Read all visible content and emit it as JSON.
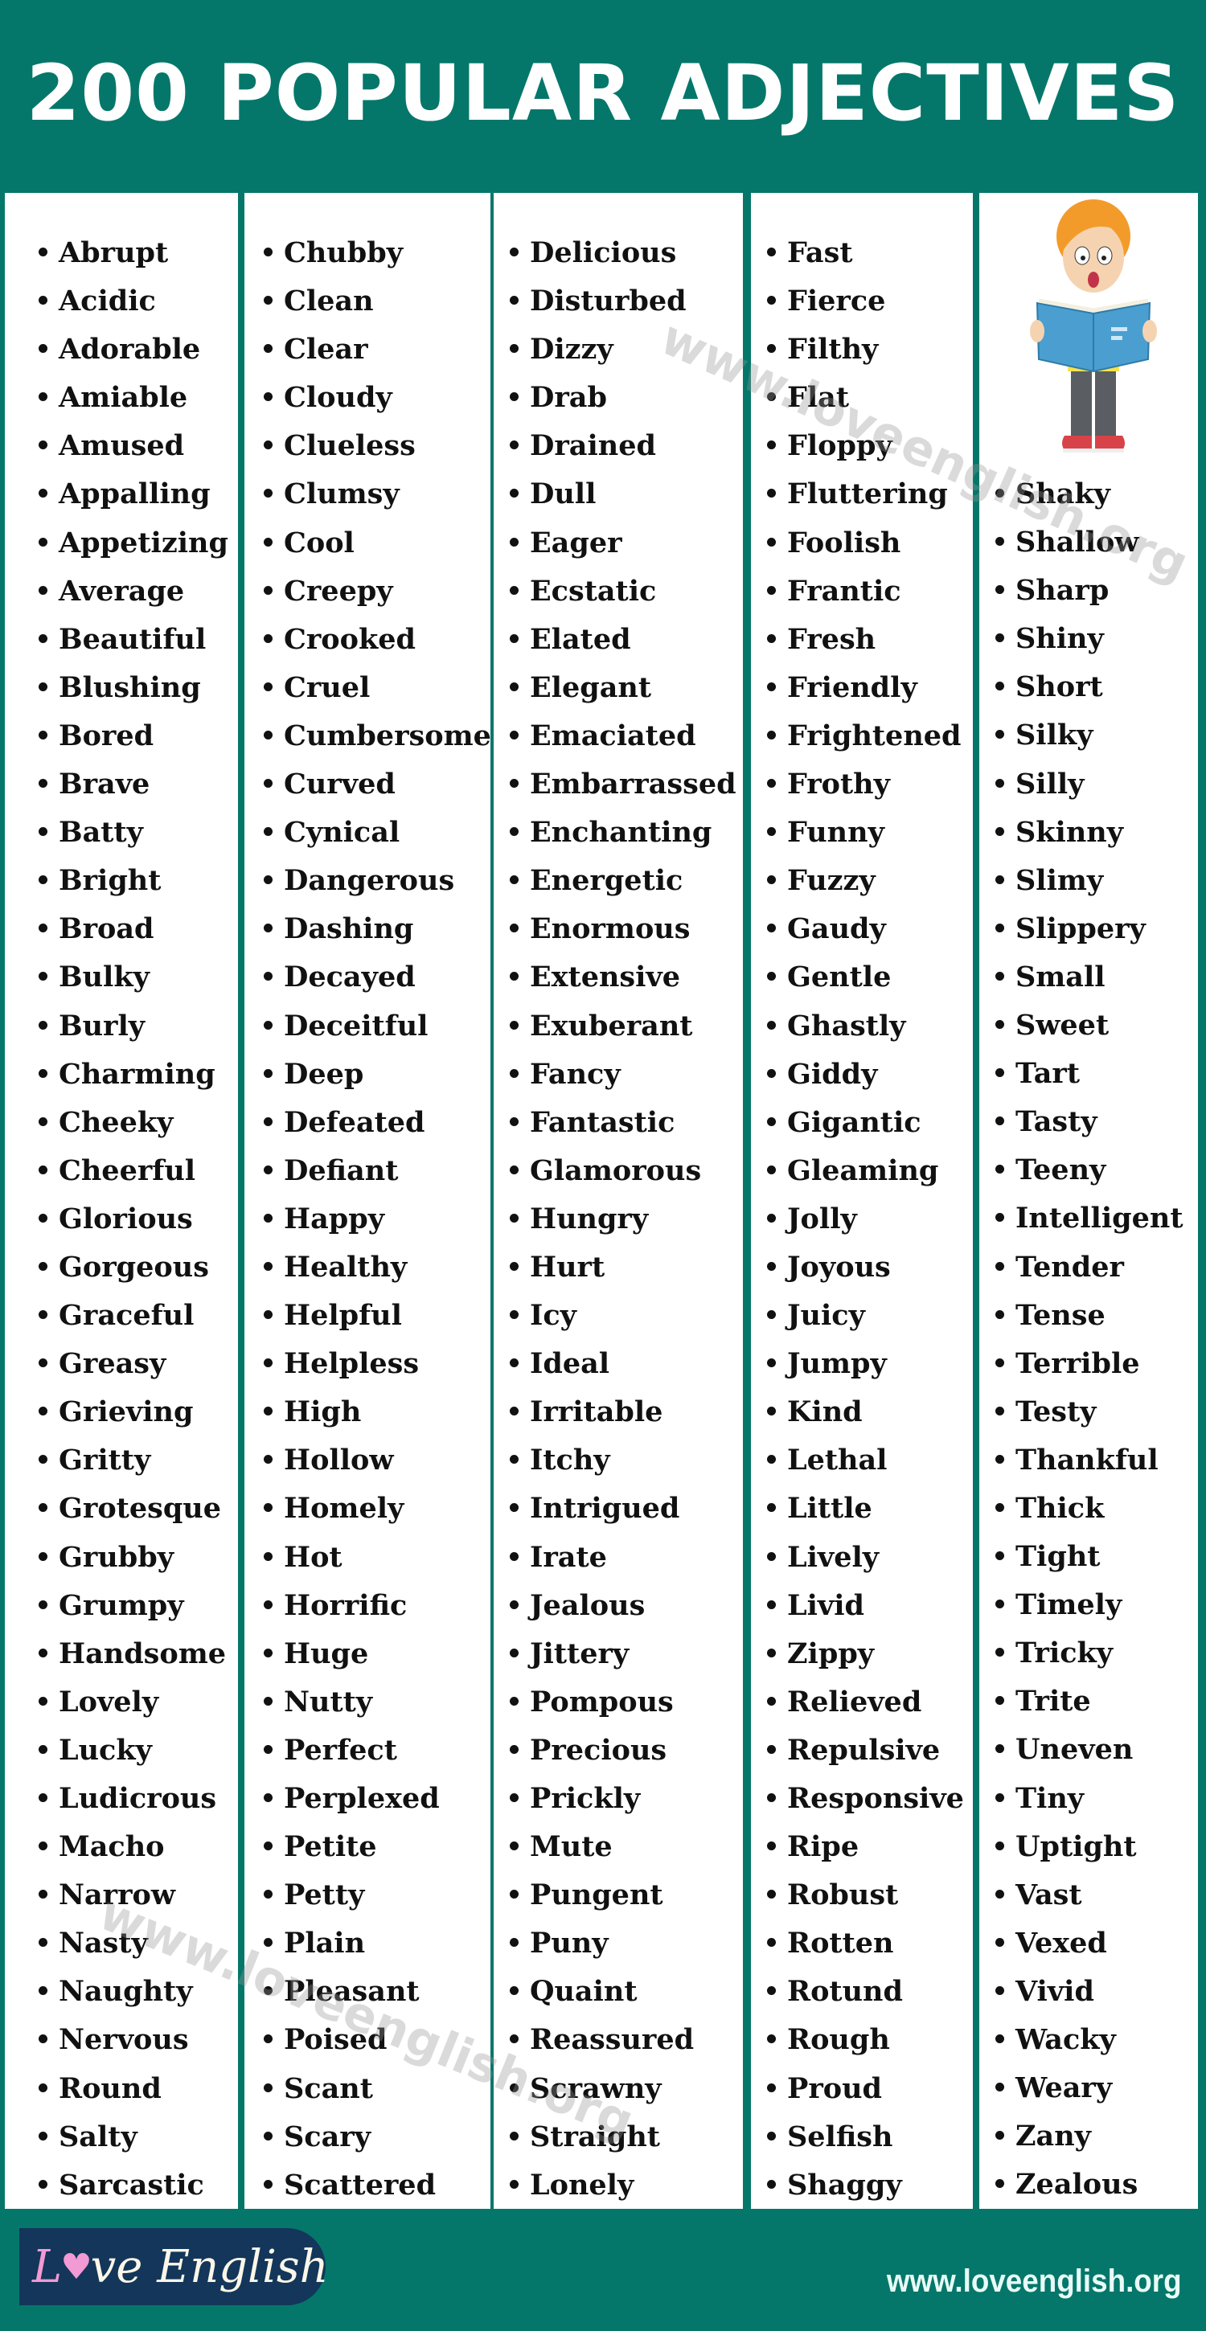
{
  "header": {
    "title": "200 POPULAR ADJECTIVES"
  },
  "colors": {
    "background": "#04776a",
    "panel": "#ffffff",
    "logo_bg": "#13365a",
    "logo_pink": "#f29ad3"
  },
  "columns": [
    [
      "Abrupt",
      "Acidic",
      "Adorable",
      "Amiable",
      "Amused",
      "Appalling",
      "Appetizing",
      "Average",
      "Beautiful",
      "Blushing",
      "Bored",
      "Brave",
      "Batty",
      "Bright",
      "Broad",
      "Bulky",
      "Burly",
      "Charming",
      "Cheeky",
      "Cheerful",
      "Glorious",
      "Gorgeous",
      "Graceful",
      "Greasy",
      "Grieving",
      "Gritty",
      "Grotesque",
      "Grubby",
      "Grumpy",
      "Handsome",
      "Lovely",
      "Lucky",
      "Ludicrous",
      "Macho",
      "Narrow",
      "Nasty",
      "Naughty",
      "Nervous",
      "Round",
      "Salty",
      "Sarcastic"
    ],
    [
      "Chubby",
      "Clean",
      "Clear",
      "Cloudy",
      "Clueless",
      "Clumsy",
      "Cool",
      "Creepy",
      "Crooked",
      "Cruel",
      "Cumbersome",
      "Curved",
      "Cynical",
      "Dangerous",
      "Dashing",
      "Decayed",
      "Deceitful",
      "Deep",
      "Defeated",
      "Defiant",
      "Happy",
      "Healthy",
      "Helpful",
      "Helpless",
      "High",
      "Hollow",
      "Homely",
      "Hot",
      "Horrific",
      "Huge",
      "Nutty",
      "Perfect",
      "Perplexed",
      "Petite",
      "Petty",
      "Plain",
      "Pleasant",
      "Poised",
      "Scant",
      "Scary",
      "Scattered"
    ],
    [
      "Delicious",
      "Disturbed",
      "Dizzy",
      "Drab",
      "Drained",
      "Dull",
      "Eager",
      "Ecstatic",
      "Elated",
      "Elegant",
      "Emaciated",
      "Embarrassed",
      "Enchanting",
      "Energetic",
      "Enormous",
      "Extensive",
      "Exuberant",
      "Fancy",
      "Fantastic",
      "Glamorous",
      "Hungry",
      "Hurt",
      "Icy",
      "Ideal",
      "Irritable",
      "Itchy",
      "Intrigued",
      "Irate",
      "Jealous",
      "Jittery",
      "Pompous",
      "Precious",
      "Prickly",
      "Mute",
      "Pungent",
      "Puny",
      "Quaint",
      "Reassured",
      "Scrawny",
      "Straight",
      "Lonely"
    ],
    [
      "Fast",
      "Fierce",
      "Filthy",
      "Flat",
      "Floppy",
      "Fluttering",
      "Foolish",
      "Frantic",
      "Fresh",
      "Friendly",
      "Frightened",
      "Frothy",
      "Funny",
      "Fuzzy",
      "Gaudy",
      "Gentle",
      "Ghastly",
      "Giddy",
      "Gigantic",
      "Gleaming",
      "Jolly",
      "Joyous",
      "Juicy",
      "Jumpy",
      "Kind",
      "Lethal",
      "Little",
      "Lively",
      "Livid",
      "Zippy",
      "Relieved",
      "Repulsive",
      "Responsive",
      "Ripe",
      "Robust",
      "Rotten",
      "Rotund",
      "Rough",
      "Proud",
      "Selfish",
      "Shaggy"
    ],
    [
      "Shaky",
      "Shallow",
      "Sharp",
      "Shiny",
      "Short",
      "Silky",
      "Silly",
      "Skinny",
      "Slimy",
      "Slippery",
      "Small",
      "Sweet",
      "Tart",
      "Tasty",
      "Teeny",
      "Intelligent",
      "Tender",
      "Tense",
      "Terrible",
      "Testy",
      "Thankful",
      "Thick",
      "Tight",
      "Timely",
      "Tricky",
      "Trite",
      "Uneven",
      "Tiny",
      "Uptight",
      "Vast",
      "Vexed",
      "Vivid",
      "Wacky",
      "Weary",
      "Zany",
      "Zealous"
    ]
  ],
  "illustration": {
    "icon": "boy-reading-book-icon"
  },
  "watermark": "www.loveenglish.org",
  "footer": {
    "logo_first": "L",
    "logo_heart": "♥",
    "logo_rest_of_love": "ve",
    "logo_english": "English",
    "website": "www.loveenglish.org"
  }
}
